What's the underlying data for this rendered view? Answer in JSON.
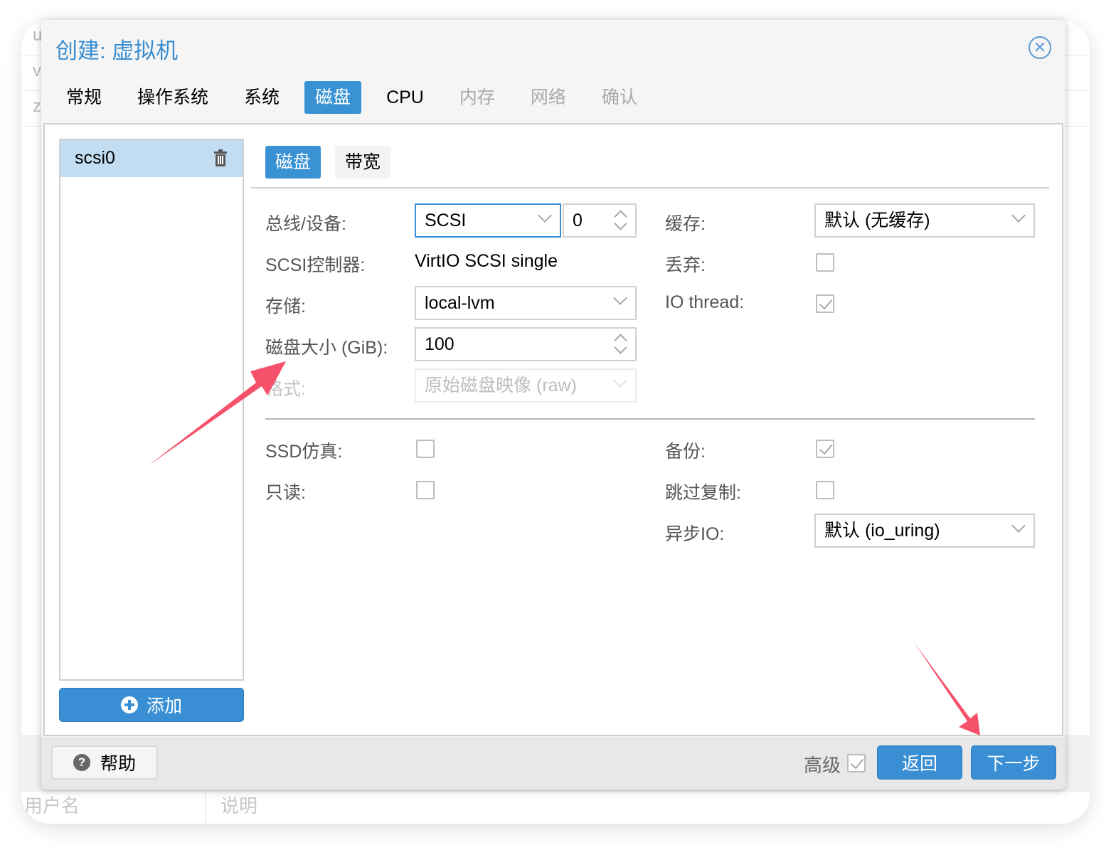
{
  "background": {
    "rows": [
      "u",
      "v",
      "z"
    ],
    "footer_cols": [
      "用户名",
      "说明"
    ]
  },
  "dialog": {
    "title": "创建: 虚拟机",
    "close_icon": "close-circle-icon",
    "tabs": [
      {
        "label": "常规",
        "state": "normal"
      },
      {
        "label": "操作系统",
        "state": "normal"
      },
      {
        "label": "系统",
        "state": "normal"
      },
      {
        "label": "磁盘",
        "state": "active"
      },
      {
        "label": "CPU",
        "state": "normal"
      },
      {
        "label": "内存",
        "state": "disabled"
      },
      {
        "label": "网络",
        "state": "disabled"
      },
      {
        "label": "确认",
        "state": "disabled"
      }
    ]
  },
  "disk_list": {
    "items": [
      {
        "name": "scsi0",
        "icon": "trash-icon"
      }
    ],
    "add_label": "添加"
  },
  "subtabs": [
    {
      "label": "磁盘",
      "active": true
    },
    {
      "label": "带宽",
      "active": false
    }
  ],
  "form": {
    "bus_device": {
      "label": "总线/设备:",
      "bus": "SCSI",
      "device": "0"
    },
    "scsi_controller": {
      "label": "SCSI控制器:",
      "value": "VirtIO SCSI single"
    },
    "storage": {
      "label": "存储:",
      "value": "local-lvm"
    },
    "disk_size": {
      "label": "磁盘大小 (GiB):",
      "value": "100"
    },
    "format": {
      "label": "格式:",
      "value": "原始磁盘映像 (raw)"
    },
    "cache": {
      "label": "缓存:",
      "value": "默认 (无缓存)"
    },
    "discard": {
      "label": "丢弃:",
      "checked": false
    },
    "io_thread": {
      "label": "IO thread:",
      "checked": true
    },
    "ssd_emulation": {
      "label": "SSD仿真:",
      "checked": false
    },
    "read_only": {
      "label": "只读:",
      "checked": false
    },
    "backup": {
      "label": "备份:",
      "checked": true
    },
    "skip_replication": {
      "label": "跳过复制:",
      "checked": false
    },
    "async_io": {
      "label": "异步IO:",
      "value": "默认 (io_uring)"
    }
  },
  "footer": {
    "help_label": "帮助",
    "advanced_label": "高级",
    "advanced_checked": true,
    "back_label": "返回",
    "next_label": "下一步"
  },
  "annotations": {
    "arrow_color": "#f5516a"
  }
}
